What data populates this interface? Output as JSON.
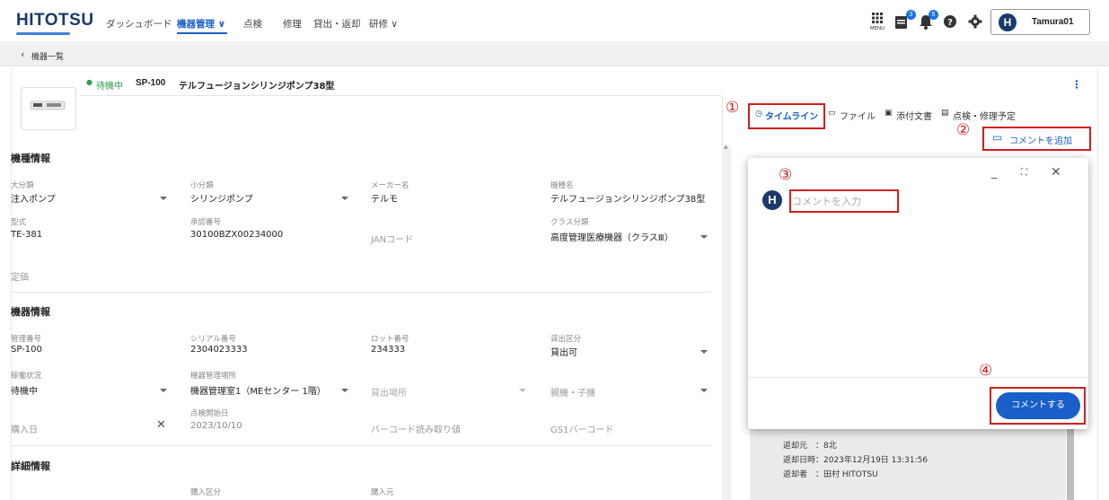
{
  "header": {
    "logo": "HITOTSU",
    "nav": [
      {
        "label": "ダッシュボード"
      },
      {
        "label": "機器管理 ∨"
      },
      {
        "label": "点検"
      },
      {
        "label": "修理"
      },
      {
        "label": "貸出・返却"
      },
      {
        "label": "研修 ∨"
      }
    ],
    "menu_label": "MENU",
    "notify_count_1": "3",
    "notify_count_2": "5",
    "user_initial": "H",
    "username": "Tamura01"
  },
  "breadcrumb": {
    "back_label": "機器一覧"
  },
  "device": {
    "status": "待機中",
    "code": "SP-100",
    "name": "テルフュージョンシリンジポンプ38型"
  },
  "model_info": {
    "title": "機種情報",
    "fields": [
      {
        "label": "大分類",
        "value": "注入ポンプ"
      },
      {
        "label": "小分類",
        "value": "シリンジポンプ"
      },
      {
        "label": "メーカー名",
        "value": "テルモ"
      },
      {
        "label": "機種名",
        "value": "テルフュージョンシリンジポンプ38型"
      },
      {
        "label": "型式",
        "value": "TE-381"
      },
      {
        "label": "承認番号",
        "value": "30100BZX00234000"
      },
      {
        "label": "",
        "value": "JANコード"
      },
      {
        "label": "クラス分類",
        "value": "高度管理医療機器（クラスⅢ）"
      },
      {
        "label": "",
        "value": "定価"
      }
    ]
  },
  "equipment_info": {
    "title": "機器情報",
    "fields": [
      {
        "label": "管理番号",
        "value": "SP-100"
      },
      {
        "label": "シリアル番号",
        "value": "2304023333"
      },
      {
        "label": "ロット番号",
        "value": "234333"
      },
      {
        "label": "貸出区分",
        "value": "貸出可"
      },
      {
        "label": "稼働状況",
        "value": "待機中"
      },
      {
        "label": "機器管理場所",
        "value": "機器管理室1（MEセンター 1階）"
      },
      {
        "label": "",
        "value": "貸出場所"
      },
      {
        "label": "",
        "value": "親機・子機"
      },
      {
        "label": "",
        "value": "購入日"
      },
      {
        "label": "点検開始日",
        "value": "2023/10/10"
      },
      {
        "label": "",
        "value": "バーコード読み取り値"
      },
      {
        "label": "",
        "value": "GS1バーコード"
      }
    ]
  },
  "detail_info": {
    "title": "詳細情報",
    "fields": [
      {
        "label": "購入区分"
      },
      {
        "label": "購入元"
      }
    ]
  },
  "tabs": [
    {
      "label": "タイムライン"
    },
    {
      "label": "ファイル"
    },
    {
      "label": "添付文書"
    },
    {
      "label": "点検・修理予定"
    }
  ],
  "add_comment_label": "コメントを追加",
  "dialog": {
    "avatar_initial": "H",
    "input_placeholder": "コメントを入力",
    "submit_label": "コメントする"
  },
  "timeline_entry": {
    "line1": "返却元　：8北",
    "line2": "返却日時：2023年12月19日 13:31:56",
    "line3": "返却者　：田村 HITOTSU"
  },
  "annotations": [
    "①",
    "②",
    "③",
    "④"
  ],
  "colors": {
    "accent": "#1a5fc9",
    "brand": "#1b3a6b",
    "status_green": "#2e9e4f",
    "annotation_red": "#d21f1f"
  }
}
